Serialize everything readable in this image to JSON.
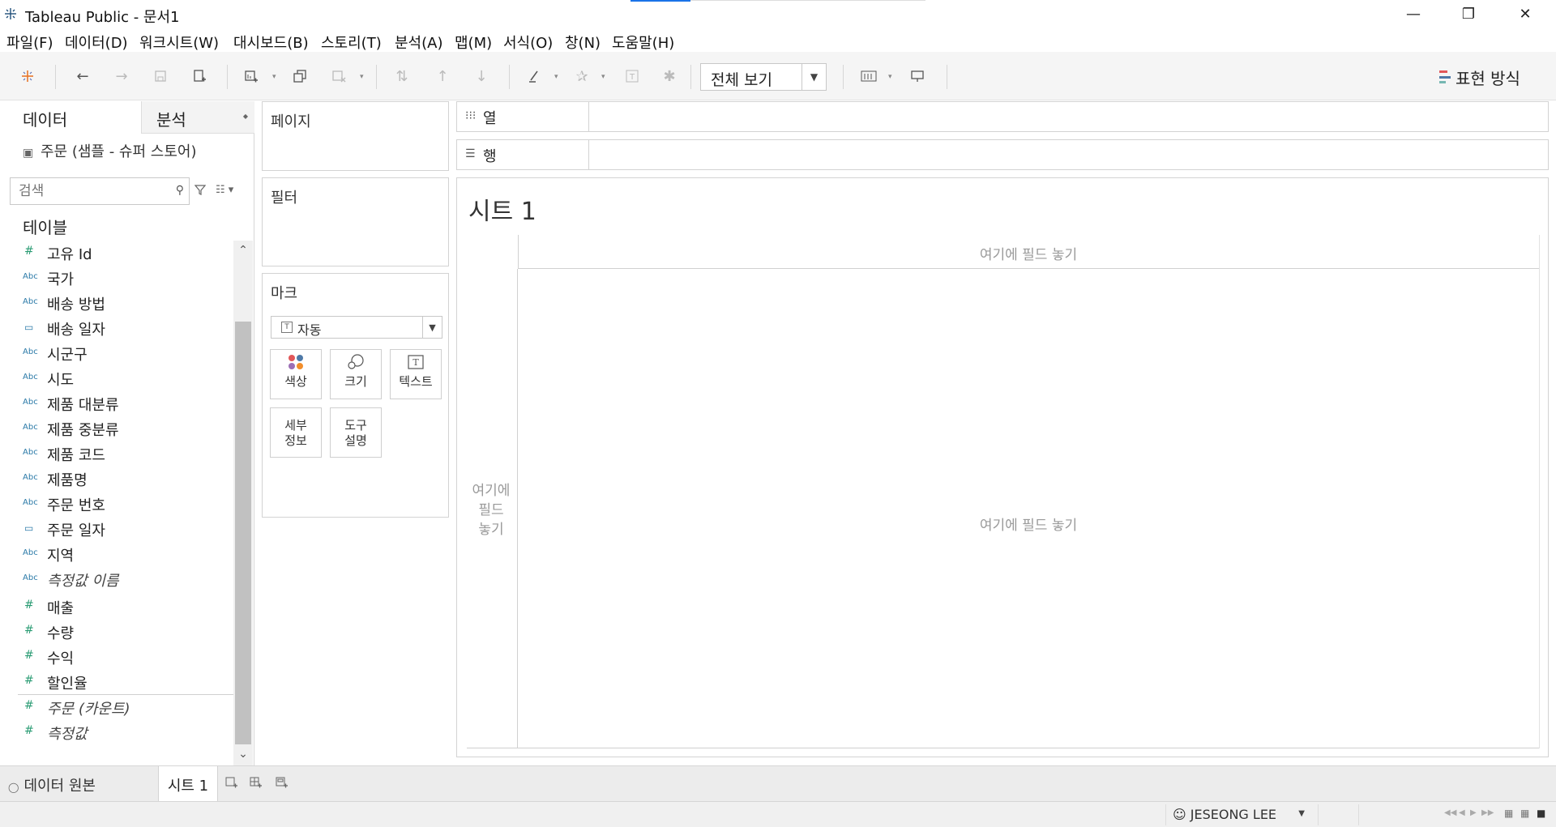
{
  "window": {
    "title": "Tableau Public - 문서1",
    "minimize": "—",
    "restore": "❐",
    "close": "✕"
  },
  "menu": [
    "파일(F)",
    "데이터(D)",
    "워크시트(W)",
    "대시보드(B)",
    "스토리(T)",
    "분석(A)",
    "맵(M)",
    "서식(O)",
    "창(N)",
    "도움말(H)"
  ],
  "toolbar": {
    "fit_value": "전체 보기",
    "show_me_label": "표현 방식"
  },
  "datapane": {
    "tab_data": "데이터",
    "tab_analysis": "분석",
    "datasource": "주문 (샘플 - 슈퍼 스토어)",
    "search_placeholder": "검색",
    "tables_header": "테이블",
    "fields": [
      {
        "type": "measure",
        "type_icon": "#",
        "name": "고유 Id",
        "italic": false
      },
      {
        "type": "string",
        "type_icon": "Abc",
        "name": "국가",
        "italic": false
      },
      {
        "type": "string",
        "type_icon": "Abc",
        "name": "배송 방법",
        "italic": false
      },
      {
        "type": "date",
        "type_icon": "▭",
        "name": "배송 일자",
        "italic": false
      },
      {
        "type": "string",
        "type_icon": "Abc",
        "name": "시군구",
        "italic": false
      },
      {
        "type": "string",
        "type_icon": "Abc",
        "name": "시도",
        "italic": false
      },
      {
        "type": "string",
        "type_icon": "Abc",
        "name": "제품 대분류",
        "italic": false
      },
      {
        "type": "string",
        "type_icon": "Abc",
        "name": "제품 중분류",
        "italic": false
      },
      {
        "type": "string",
        "type_icon": "Abc",
        "name": "제품 코드",
        "italic": false
      },
      {
        "type": "string",
        "type_icon": "Abc",
        "name": "제품명",
        "italic": false
      },
      {
        "type": "string",
        "type_icon": "Abc",
        "name": "주문 번호",
        "italic": false
      },
      {
        "type": "date",
        "type_icon": "▭",
        "name": "주문 일자",
        "italic": false
      },
      {
        "type": "string",
        "type_icon": "Abc",
        "name": "지역",
        "italic": false
      },
      {
        "type": "string",
        "type_icon": "Abc",
        "name": "측정값 이름",
        "italic": true
      },
      {
        "type": "measure",
        "type_icon": "#",
        "name": "매출",
        "italic": false
      },
      {
        "type": "measure",
        "type_icon": "#",
        "name": "수량",
        "italic": false
      },
      {
        "type": "measure",
        "type_icon": "#",
        "name": "수익",
        "italic": false
      },
      {
        "type": "measure",
        "type_icon": "#",
        "name": "할인율",
        "italic": false
      },
      {
        "type": "measure",
        "type_icon": "#",
        "name": "주문 (카운트)",
        "italic": true
      },
      {
        "type": "measure",
        "type_icon": "#",
        "name": "측정값",
        "italic": true
      }
    ]
  },
  "cards": {
    "pages": "페이지",
    "filters": "필터",
    "marks": "마크",
    "marks_type": "자동",
    "mark_buttons": {
      "color": "색상",
      "size": "크기",
      "text": "텍스트",
      "detail_1": "세부",
      "detail_2": "정보",
      "tooltip_1": "도구",
      "tooltip_2": "설명"
    }
  },
  "shelves": {
    "columns": "열",
    "rows": "행"
  },
  "view": {
    "sheet_title": "시트 1",
    "drop_top": "여기에 필드 놓기",
    "drop_left_1": "여기에",
    "drop_left_2": "필드",
    "drop_left_3": "놓기",
    "drop_main": "여기에 필드 놓기"
  },
  "tabs": {
    "datasource": "데이터 원본",
    "sheet1": "시트 1"
  },
  "status": {
    "user": "JESEONG LEE"
  },
  "colors": {
    "dim_blue": "#2b7aa8",
    "measure_green": "#2b9c74",
    "accent_blue": "#1a73e8"
  }
}
